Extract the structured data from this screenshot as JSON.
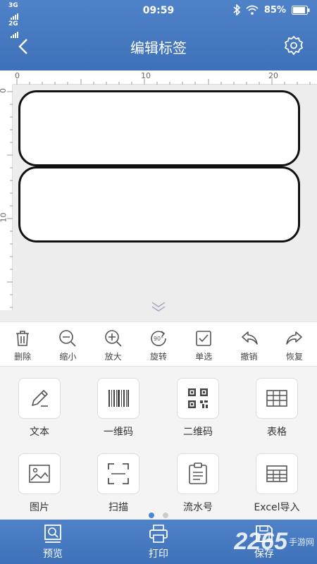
{
  "status_bar": {
    "network_1": "3G",
    "network_2": "2G",
    "time": "09:59",
    "battery": "85%"
  },
  "nav": {
    "title": "编辑标签",
    "back_icon": "chevron-left-icon",
    "settings_icon": "gear-icon"
  },
  "ruler": {
    "top_labels": [
      "0",
      "10",
      "20"
    ],
    "left_labels": [
      "0",
      "10"
    ]
  },
  "canvas": {
    "labels": 2,
    "collapse_icon": "double-chevron-down-icon"
  },
  "toolbar": [
    {
      "label": "删除",
      "icon": "trash-icon"
    },
    {
      "label": "缩小",
      "icon": "zoom-out-icon"
    },
    {
      "label": "放大",
      "icon": "zoom-in-icon"
    },
    {
      "label": "旋转",
      "icon": "rotate-90-icon",
      "icon_text": "90°"
    },
    {
      "label": "单选",
      "icon": "checkbox-icon"
    },
    {
      "label": "撤销",
      "icon": "undo-icon"
    },
    {
      "label": "恢复",
      "icon": "redo-icon"
    }
  ],
  "elements": [
    {
      "label": "文本",
      "icon": "pencil-icon"
    },
    {
      "label": "一维码",
      "icon": "barcode-icon"
    },
    {
      "label": "二维码",
      "icon": "qrcode-icon"
    },
    {
      "label": "表格",
      "icon": "table-icon"
    },
    {
      "label": "图片",
      "icon": "image-icon"
    },
    {
      "label": "扫描",
      "icon": "scan-icon"
    },
    {
      "label": "流水号",
      "icon": "clipboard-icon"
    },
    {
      "label": "Excel导入",
      "icon": "excel-table-icon"
    }
  ],
  "pager": {
    "pages": 2,
    "active": 1,
    "active_color": "#4a86d4",
    "inactive_color": "#cccccc"
  },
  "bottom_bar": [
    {
      "label": "预览",
      "icon": "preview-icon"
    },
    {
      "label": "打印",
      "icon": "printer-icon"
    },
    {
      "label": "保存",
      "icon": "save-icon"
    }
  ],
  "watermark": {
    "text_large": "2265",
    "text_small": "手游网"
  },
  "colors": {
    "brand_blue": "#4478c0",
    "label_border": "#111111"
  }
}
